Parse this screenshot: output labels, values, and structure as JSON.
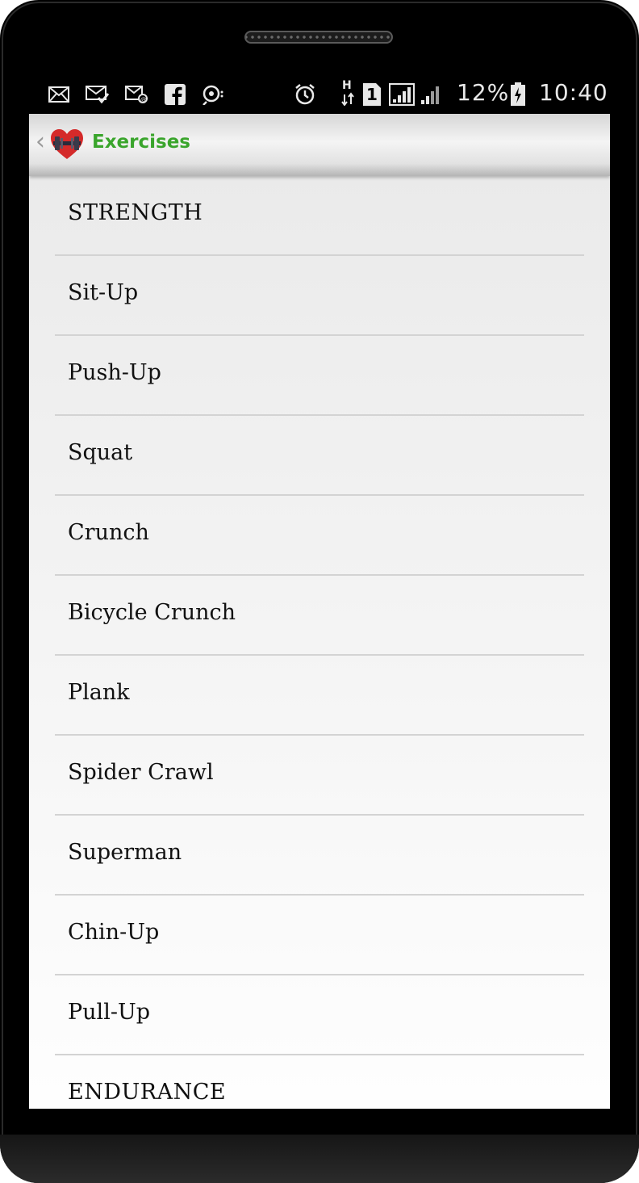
{
  "status_bar": {
    "battery_percent": "12%",
    "time": "10:40",
    "network_type": "H",
    "sim_slot": "1",
    "icons": [
      "mail-icon",
      "mail-check-icon",
      "email-sync-icon",
      "facebook-icon",
      "usb-debug-icon",
      "alarm-icon",
      "network-h-icon",
      "sim-1-icon",
      "signal-icon",
      "signal-icon",
      "battery-charging-icon"
    ]
  },
  "action_bar": {
    "title": "Exercises",
    "title_color": "#3aa52c"
  },
  "exercises": {
    "items": [
      {
        "label": "STRENGTH",
        "type": "header"
      },
      {
        "label": "Sit-Up",
        "type": "item"
      },
      {
        "label": "Push-Up",
        "type": "item"
      },
      {
        "label": "Squat",
        "type": "item"
      },
      {
        "label": "Crunch",
        "type": "item"
      },
      {
        "label": "Bicycle Crunch",
        "type": "item"
      },
      {
        "label": "Plank",
        "type": "item"
      },
      {
        "label": "Spider Crawl",
        "type": "item"
      },
      {
        "label": "Superman",
        "type": "item"
      },
      {
        "label": "Chin-Up",
        "type": "item"
      },
      {
        "label": "Pull-Up",
        "type": "item"
      },
      {
        "label": "ENDURANCE",
        "type": "header"
      }
    ]
  }
}
